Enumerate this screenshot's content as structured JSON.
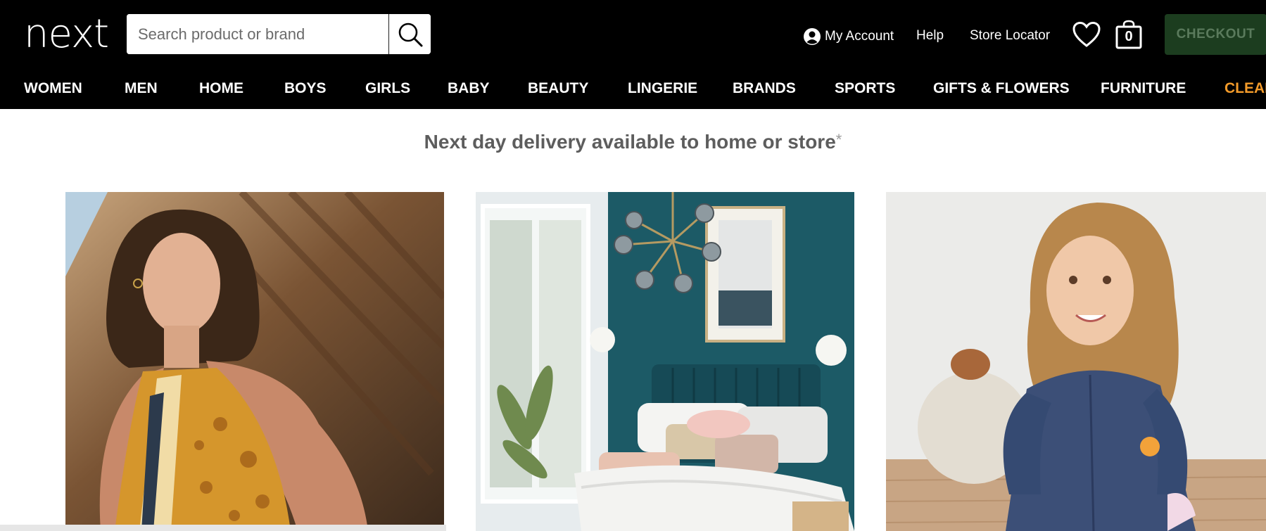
{
  "brand": {
    "logo_text": "next"
  },
  "search": {
    "placeholder": "Search product or brand",
    "value": ""
  },
  "header": {
    "account_label": "My Account",
    "help_label": "Help",
    "store_locator_label": "Store Locator",
    "bag_count": "0",
    "checkout_label": "CHECKOUT"
  },
  "nav": {
    "items": [
      {
        "label": "WOMEN"
      },
      {
        "label": "MEN"
      },
      {
        "label": "HOME"
      },
      {
        "label": "BOYS"
      },
      {
        "label": "GIRLS"
      },
      {
        "label": "BABY"
      },
      {
        "label": "BEAUTY"
      },
      {
        "label": "LINGERIE"
      },
      {
        "label": "BRANDS"
      },
      {
        "label": "SPORTS"
      },
      {
        "label": "GIFTS & FLOWERS"
      },
      {
        "label": "FURNITURE"
      },
      {
        "label": "CLEAR"
      }
    ]
  },
  "banner": {
    "text": "Next day delivery available to home or store",
    "asterisk": "*"
  },
  "promos": [
    {
      "icon": "womenswear-photo"
    },
    {
      "icon": "bedroom-photo"
    },
    {
      "icon": "girls-dress-photo"
    }
  ],
  "colors": {
    "header_bg": "#000000",
    "checkout_bg": "#1c3d1f",
    "clearance_accent": "#f39b2a",
    "banner_text": "#5d5d5d"
  }
}
